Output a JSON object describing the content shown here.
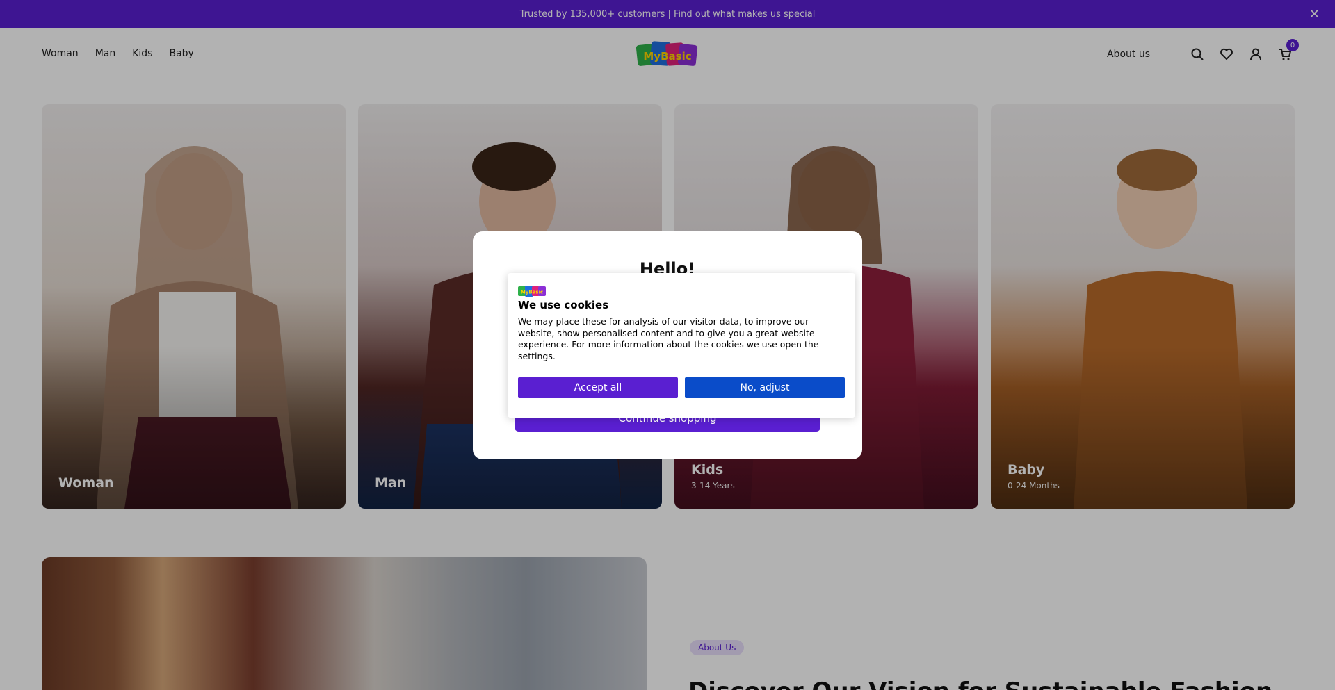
{
  "announcement": {
    "text": "Trusted by 135,000+ customers | Find out what makes us special",
    "close_icon": "close-icon"
  },
  "header": {
    "nav": [
      "Woman",
      "Man",
      "Kids",
      "Baby"
    ],
    "about_label": "About us",
    "cart_count": "0",
    "icons": [
      "search-icon",
      "heart-icon",
      "user-icon",
      "cart-icon"
    ],
    "logo_text": "MyBasic"
  },
  "categories": [
    {
      "title": "Woman",
      "subtitle": ""
    },
    {
      "title": "Man",
      "subtitle": ""
    },
    {
      "title": "Kids",
      "subtitle": "3-14 Years"
    },
    {
      "title": "Baby",
      "subtitle": "0-24 Months"
    }
  ],
  "about": {
    "tag": "About Us",
    "heading": "Discover Our Vision for Sustainable Fashion"
  },
  "modal": {
    "title": "Hello!",
    "continue_label": "Continue shopping"
  },
  "cookie": {
    "title": "We use cookies",
    "text": "We may place these for analysis of our visitor data, to improve our website, show personalised content and to give you a great website experience. For more information about the cookies we use open the settings.",
    "accept_label": "Accept all",
    "adjust_label": "No, adjust"
  },
  "colors": {
    "brand_purple": "#5a1fd1",
    "adjust_blue": "#0a4cc9"
  }
}
